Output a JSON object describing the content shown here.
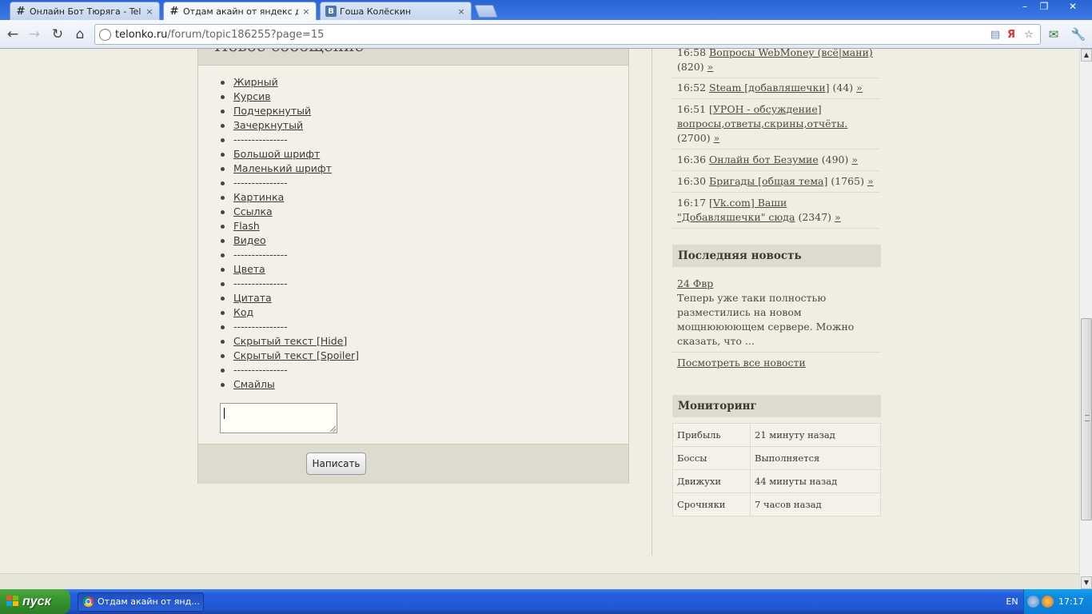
{
  "browser": {
    "tabs": [
      {
        "favicon": "#",
        "title": "Онлайн Бот Тюряга - Telonk",
        "active": false
      },
      {
        "favicon": "#",
        "title": "Отдам акайн от яндекс ден",
        "active": true
      },
      {
        "favicon": "B",
        "title": "Гоша Колёскин",
        "active": false
      }
    ],
    "close_glyph": "×",
    "window_controls": {
      "minimize": "–",
      "maximize": "❐",
      "close": "✕"
    },
    "nav": {
      "back": "←",
      "forward": "→",
      "reload": "↻",
      "home": "⌂"
    },
    "url": {
      "host": "telonko.ru",
      "path": "/forum/topic186255?page=15"
    },
    "toolbar_icons": [
      "page-icon",
      "yandex-icon",
      "star-icon",
      "mail-icon",
      "wrench-icon"
    ]
  },
  "form": {
    "header": "Новое сообщение",
    "bbcodes": [
      "Жирный",
      "Курсив",
      "Подчеркнутый",
      "Зачеркнутый",
      "---------------",
      "Большой шрифт",
      "Маленький шрифт",
      "---------------",
      "Картинка",
      "Ссылка",
      "Flash",
      "Видео",
      "---------------",
      "Цвета",
      "---------------",
      "Цитата",
      "Код",
      "---------------",
      "Скрытый текст [Hide]",
      "Скрытый текст [Spoiler]",
      "---------------",
      "Смайлы"
    ],
    "message_value": "",
    "submit_label": "Написать"
  },
  "sidebar": {
    "topics": [
      {
        "time": "16:58",
        "title": "Вопросы WebMoney (всё|мани)",
        "count": "(820)",
        "arrow": "»"
      },
      {
        "time": "16:52",
        "title": "Steam [добавляшечки]",
        "count": "(44)",
        "arrow": "»"
      },
      {
        "time": "16:51",
        "title": "[УРОН - обсуждение] вопросы,ответы,скрины,отчёты.",
        "count": "(2700)",
        "arrow": "»"
      },
      {
        "time": "16:36",
        "title": "Онлайн бот Безумие",
        "count": "(490)",
        "arrow": "»"
      },
      {
        "time": "16:30",
        "title": "Бригады [общая тема]",
        "count": "(1765)",
        "arrow": "»"
      },
      {
        "time": "16:17",
        "title": "[Vk.com] Ваши \"Добавляшечки\" сюда",
        "count": "(2347)",
        "arrow": "»"
      }
    ],
    "news": {
      "header": "Последняя новость",
      "date": "24 Фвр",
      "text": "Теперь уже таки полностью разместились на новом мощнюююющем сервере. Можно сказать, что ...",
      "all_link": "Посмотреть все новости"
    },
    "monitoring": {
      "header": "Мониторинг",
      "rows": [
        {
          "key": "Прибыль",
          "value": "21 минуту назад"
        },
        {
          "key": "Боссы",
          "value": "Выполняется"
        },
        {
          "key": "Движухи",
          "value": "44 минуты назад"
        },
        {
          "key": "Срочняки",
          "value": "7 часов назад"
        }
      ]
    }
  },
  "taskbar": {
    "start_label": "пуск",
    "item_label": "Отдам акайн от янд...",
    "lang": "EN",
    "clock": "17:17"
  },
  "colors": {
    "page_bg": "#efeee5",
    "panel_header": "#dddbcf",
    "text": "#4b4b40",
    "taskbar": "#245edb",
    "start_green": "#37962f"
  }
}
